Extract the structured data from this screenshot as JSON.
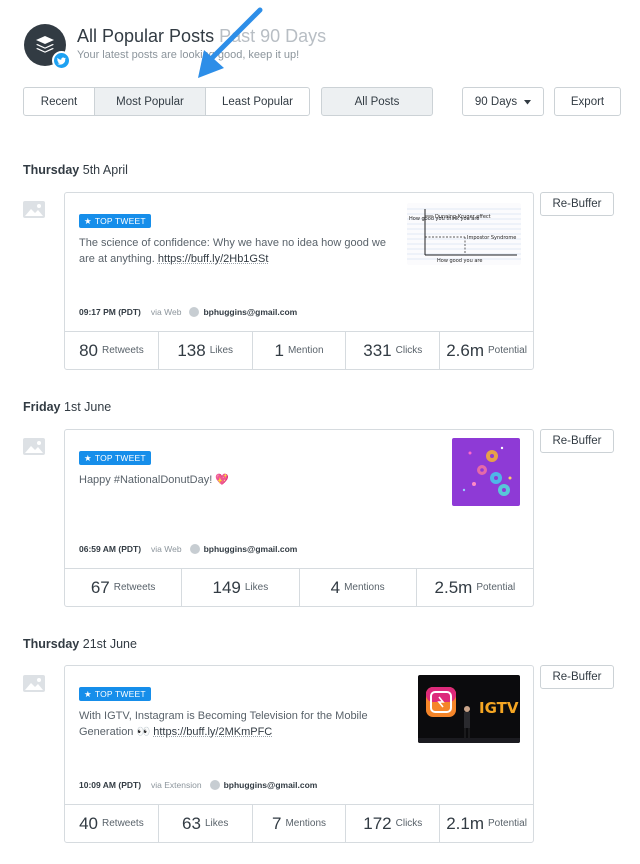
{
  "header": {
    "title_main": "All Popular Posts",
    "title_muted": "Past 90 Days",
    "subtitle": "Your latest posts are looking good, keep it up!"
  },
  "filters": {
    "recent": "Recent",
    "most_popular": "Most Popular",
    "least_popular": "Least Popular",
    "all_posts": "All Posts",
    "range": "90 Days",
    "export": "Export",
    "active": "Most Popular"
  },
  "posts": [
    {
      "day_name": "Thursday",
      "day_date": "5th April",
      "badge": "TOP TWEET",
      "text": "The science of confidence: Why we have no idea how good we are at anything.",
      "link": "https://buff.ly/2Hb1GSt",
      "time": "09:17 PM (PDT)",
      "via": "via Web",
      "account": "bphuggins@gmail.com",
      "rebuffer": "Re-Buffer",
      "thumb_texts": {
        "y_label": "How good you think you are",
        "dk": "Dunning-Kruger effect",
        "imp": "Impostor Syndrome",
        "x_label": "How good you are"
      },
      "stats": [
        {
          "n": "80",
          "l": "Retweets"
        },
        {
          "n": "138",
          "l": "Likes"
        },
        {
          "n": "1",
          "l": "Mention"
        },
        {
          "n": "331",
          "l": "Clicks"
        },
        {
          "n": "2.6m",
          "l": "Potential"
        }
      ]
    },
    {
      "day_name": "Friday",
      "day_date": "1st June",
      "badge": "TOP TWEET",
      "text": "Happy #NationalDonutDay! 💖",
      "link": "",
      "time": "06:59 AM (PDT)",
      "via": "via Web",
      "account": "bphuggins@gmail.com",
      "rebuffer": "Re-Buffer",
      "stats": [
        {
          "n": "67",
          "l": "Retweets"
        },
        {
          "n": "149",
          "l": "Likes"
        },
        {
          "n": "4",
          "l": "Mentions"
        },
        {
          "n": "2.5m",
          "l": "Potential"
        }
      ]
    },
    {
      "day_name": "Thursday",
      "day_date": "21st June",
      "badge": "TOP TWEET",
      "text": "With IGTV, Instagram is Becoming Television for the Mobile Generation 👀",
      "link": "https://buff.ly/2MKmPFC",
      "time": "10:09 AM (PDT)",
      "via": "via Extension",
      "account": "bphuggins@gmail.com",
      "rebuffer": "Re-Buffer",
      "thumb_texts": {
        "igtv": "IGTV"
      },
      "stats": [
        {
          "n": "40",
          "l": "Retweets"
        },
        {
          "n": "63",
          "l": "Likes"
        },
        {
          "n": "7",
          "l": "Mentions"
        },
        {
          "n": "172",
          "l": "Clicks"
        },
        {
          "n": "2.1m",
          "l": "Potential"
        }
      ]
    }
  ],
  "colors": {
    "badge": "#168eea",
    "arrow": "#2d8ee8",
    "twitter": "#1da1f2"
  }
}
